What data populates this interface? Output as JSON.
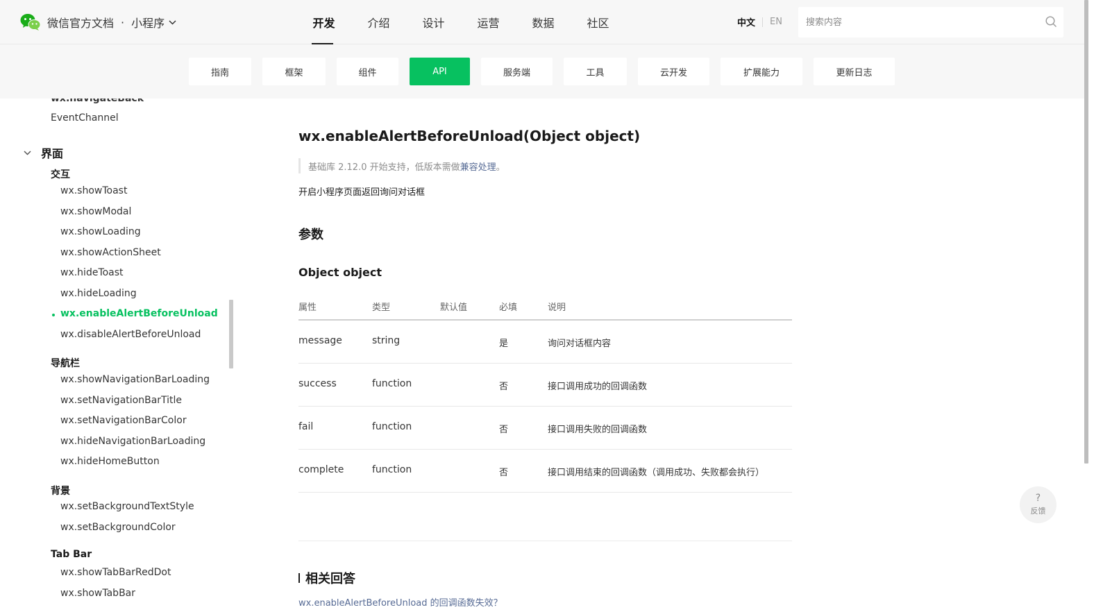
{
  "header": {
    "brand_title": "微信官方文档",
    "separator": "·",
    "product": "小程序",
    "nav": [
      {
        "label": "开发",
        "active": true
      },
      {
        "label": "介绍",
        "active": false
      },
      {
        "label": "设计",
        "active": false
      },
      {
        "label": "运营",
        "active": false
      },
      {
        "label": "数据",
        "active": false
      },
      {
        "label": "社区",
        "active": false
      }
    ],
    "lang_zh": "中文",
    "lang_en": "EN",
    "search_placeholder": "搜索内容"
  },
  "subnav": {
    "tabs": [
      {
        "label": "指南"
      },
      {
        "label": "框架"
      },
      {
        "label": "组件"
      },
      {
        "label": "API",
        "active": true
      },
      {
        "label": "服务端"
      },
      {
        "label": "工具"
      },
      {
        "label": "云开发"
      },
      {
        "label": "扩展能力"
      },
      {
        "label": "更新日志"
      }
    ]
  },
  "sidebar": {
    "cut_item": "wx.navigateBack",
    "event_channel": "EventChannel",
    "section": "界面",
    "groups": {
      "interaction": "交互",
      "navbar": "导航栏",
      "background": "背景",
      "tabbar": "Tab Bar"
    },
    "interaction_items": [
      "wx.showToast",
      "wx.showModal",
      "wx.showLoading",
      "wx.showActionSheet",
      "wx.hideToast",
      "wx.hideLoading",
      "wx.enableAlertBeforeUnload",
      "wx.disableAlertBeforeUnload"
    ],
    "navbar_items": [
      "wx.showNavigationBarLoading",
      "wx.setNavigationBarTitle",
      "wx.setNavigationBarColor",
      "wx.hideNavigationBarLoading",
      "wx.hideHomeButton"
    ],
    "background_items": [
      "wx.setBackgroundTextStyle",
      "wx.setBackgroundColor"
    ],
    "tabbar_items": [
      "wx.showTabBarRedDot",
      "wx.showTabBar"
    ]
  },
  "main": {
    "title": "wx.enableAlertBeforeUnload(Object object)",
    "note_prefix": "基础库 2.12.0 开始支持，低版本需做",
    "note_link": "兼容处理",
    "note_suffix": "。",
    "description": "开启小程序页面返回询问对话框",
    "params_heading": "参数",
    "object_heading": "Object object",
    "table": {
      "headers": [
        "属性",
        "类型",
        "默认值",
        "必填",
        "说明"
      ],
      "rows": [
        {
          "name": "message",
          "type": "string",
          "default": "",
          "required": "是",
          "desc": "询问对话框内容"
        },
        {
          "name": "success",
          "type": "function",
          "default": "",
          "required": "否",
          "desc": "接口调用成功的回调函数"
        },
        {
          "name": "fail",
          "type": "function",
          "default": "",
          "required": "否",
          "desc": "接口调用失败的回调函数"
        },
        {
          "name": "complete",
          "type": "function",
          "default": "",
          "required": "否",
          "desc": "接口调用结束的回调函数（调用成功、失败都会执行）"
        }
      ]
    },
    "related_heading": "相关回答",
    "related_link": "wx.enableAlertBeforeUnload 的回调函数失效？"
  },
  "feedback": {
    "icon": "?",
    "label": "反馈"
  },
  "colors": {
    "accent": "#07c160",
    "link": "#576b95"
  }
}
